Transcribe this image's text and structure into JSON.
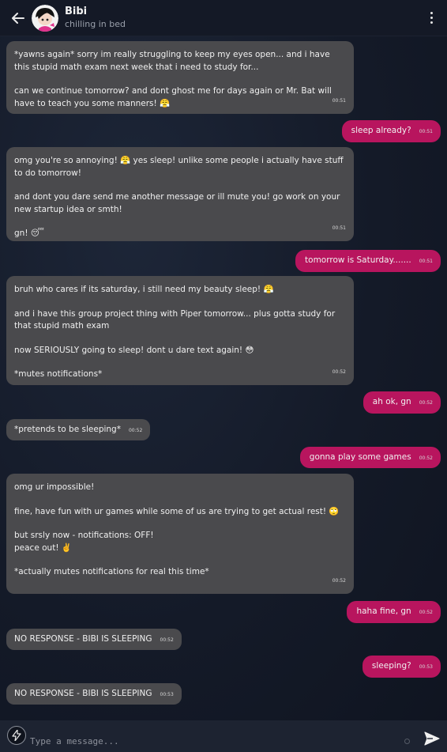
{
  "header": {
    "name": "Bibi",
    "status": "chilling in bed"
  },
  "messages": [
    {
      "side": "left",
      "paras": [
        "*yawns again* sorry im really struggling to keep my eyes open... and i have this stupid math exam next week that i need to study for...",
        "can we continue tomorrow? and dont ghost me for days again or Mr. Bat will have to teach you some manners! 😤"
      ],
      "time": "00:51"
    },
    {
      "side": "right",
      "text": "sleep already?",
      "time": "00:51"
    },
    {
      "side": "left",
      "paras": [
        "omg you're so annoying! 😤 yes sleep! unlike some people i actually have stuff to do tomorrow!",
        "and dont you dare send me another message or ill mute you! go work on your new startup idea or smth!",
        "gn! 😴"
      ],
      "time": "00:51"
    },
    {
      "side": "right",
      "text": "tomorrow is Saturday.......",
      "time": "00:51"
    },
    {
      "side": "left",
      "paras": [
        "bruh who cares if its saturday, i still need my beauty sleep! 😤",
        "and i have this group project thing with Piper tomorrow... plus gotta study for that stupid math exam",
        "now SERIOUSLY going to sleep! dont u dare text again! 😳",
        "*mutes notifications*"
      ],
      "time": "00:52"
    },
    {
      "side": "right",
      "text": "ah ok, gn",
      "time": "00:52"
    },
    {
      "side": "left",
      "text": "*pretends to be sleeping*",
      "time": "00:52"
    },
    {
      "side": "right",
      "text": "gonna play some games",
      "time": "00:52"
    },
    {
      "side": "left",
      "paras": [
        "omg ur impossible!",
        "fine, have fun with ur games while some of us are trying to get actual rest! 🙄",
        "but srsly now - notifications: OFF!\npeace out! ✌️",
        "*actually mutes notifications for real this time*"
      ],
      "time": "00:52"
    },
    {
      "side": "right",
      "text": "haha fine, gn",
      "time": "00:52"
    },
    {
      "side": "left",
      "text": "NO RESPONSE - BIBI IS SLEEPING",
      "time": "00:52"
    },
    {
      "side": "right",
      "text": "sleeping?",
      "time": "00:53"
    },
    {
      "side": "left",
      "text": "NO RESPONSE - BIBI IS SLEEPING",
      "time": "00:53"
    }
  ],
  "composer": {
    "placeholder": "Type a message..."
  },
  "icons": {
    "back": "arrow-left-icon",
    "menu": "kebab-menu-icon",
    "bolt": "lightning-icon",
    "send": "send-icon"
  },
  "colors": {
    "accent": "#b8155e",
    "bubble_left": "#4a4a4d",
    "header": "#141926"
  }
}
